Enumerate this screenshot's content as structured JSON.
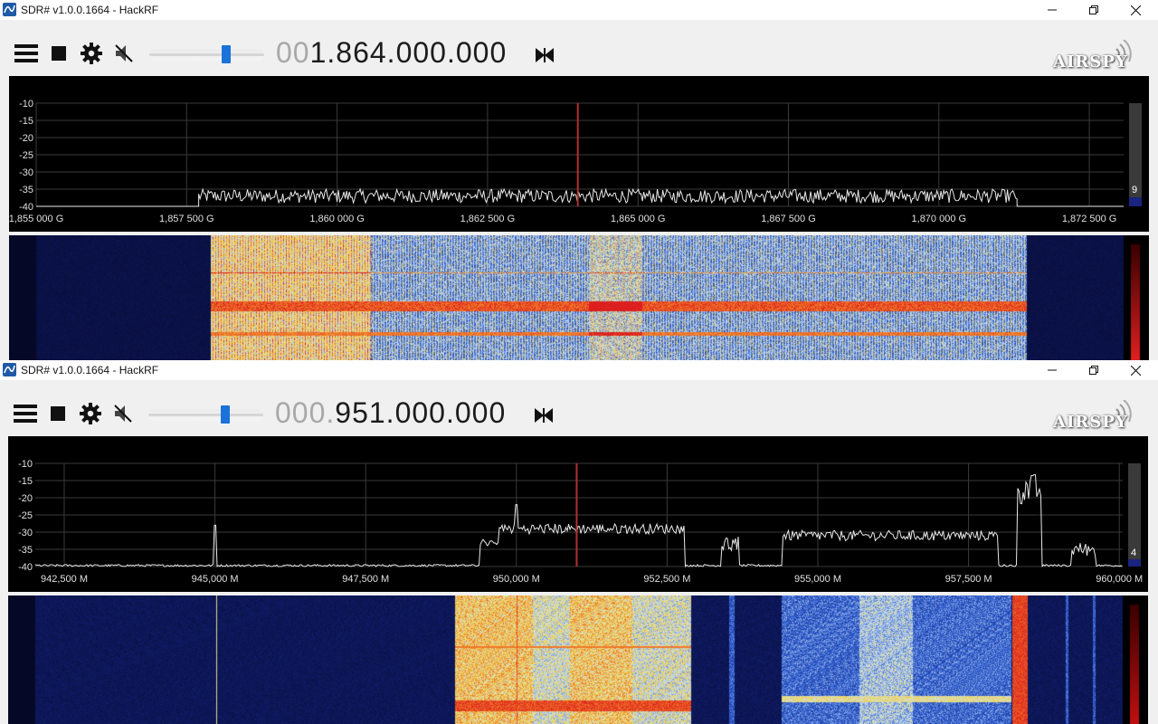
{
  "windows": [
    {
      "id": "A",
      "title": "SDR# v1.0.0.1664 - HackRF",
      "logo_text": "AIRSPY",
      "frequency": {
        "lead": "00",
        "main": "1.864.000.000"
      },
      "volume_level": 0.67,
      "spectrum": {
        "y_ticks": [
          "-10",
          "-15",
          "-20",
          "-25",
          "-30",
          "-35",
          "-40"
        ],
        "x_ticks": [
          "1,855 000 G",
          "1,857 500 G",
          "1,860 000 G",
          "1,862 500 G",
          "1,865 000 G",
          "1,867 500 G",
          "1,870 000 G",
          "1,872 500 G"
        ],
        "x_range_mhz": [
          1855.0,
          1873.9
        ],
        "y_range_db": [
          -40,
          -10
        ],
        "center_mhz": 1864.0,
        "signal_band_mhz": [
          1857.7,
          1871.3
        ],
        "level_value": "9",
        "trace_color": "#ffffff",
        "center_line_color": "#c0392b"
      }
    },
    {
      "id": "B",
      "title": "SDR# v1.0.0.1664 - HackRF",
      "logo_text": "AIRSPY",
      "frequency": {
        "lead": "000.",
        "main": "951.000.000"
      },
      "volume_level": 0.67,
      "spectrum": {
        "y_ticks": [
          "-10",
          "-15",
          "-20",
          "-25",
          "-30",
          "-35",
          "-40"
        ],
        "x_ticks": [
          "942,500 M",
          "945,000 M",
          "947,500 M",
          "950,000 M",
          "952,500 M",
          "955,000 M",
          "957,500 M",
          "960,000 M"
        ],
        "x_range_mhz": [
          942.0,
          960.0
        ],
        "y_range_db": [
          -40,
          -10
        ],
        "center_mhz": 951.0,
        "level_value": "4",
        "trace_color": "#ffffff",
        "center_line_color": "#c0392b"
      }
    }
  ]
}
